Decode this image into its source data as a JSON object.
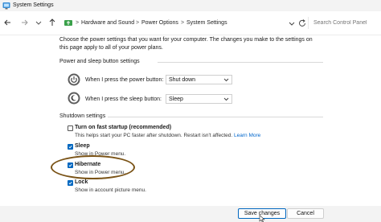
{
  "window": {
    "title": "System Settings"
  },
  "breadcrumb": {
    "items": [
      "Hardware and Sound",
      "Power Options",
      "System Settings"
    ],
    "separator": ">"
  },
  "search": {
    "placeholder": "Search Control Panel"
  },
  "intro_text": "Choose the power settings that you want for your computer. The changes you make to the settings on this page apply to all of your power plans.",
  "power_section": {
    "title": "Power and sleep button settings",
    "rows": [
      {
        "label": "When I press the power button:",
        "value": "Shut down",
        "icon": "power-button-icon"
      },
      {
        "label": "When I press the sleep button:",
        "value": "Sleep",
        "icon": "sleep-button-icon"
      }
    ]
  },
  "shutdown_section": {
    "title": "Shutdown settings",
    "options": [
      {
        "label": "Turn on fast startup (recommended)",
        "desc": "This helps start your PC faster after shutdown. Restart isn't affected.",
        "link": "Learn More",
        "checked": false
      },
      {
        "label": "Sleep",
        "desc": "Show in Power menu.",
        "checked": true
      },
      {
        "label": "Hibernate",
        "desc": "Show in Power menu.",
        "checked": true
      },
      {
        "label": "Lock",
        "desc": "Show in account picture menu.",
        "checked": true
      }
    ]
  },
  "footer": {
    "save_label": "Save changes",
    "cancel_label": "Cancel"
  },
  "colors": {
    "accent": "#0067c0",
    "link": "#0066cc",
    "highlight_ring": "#7a5316"
  }
}
